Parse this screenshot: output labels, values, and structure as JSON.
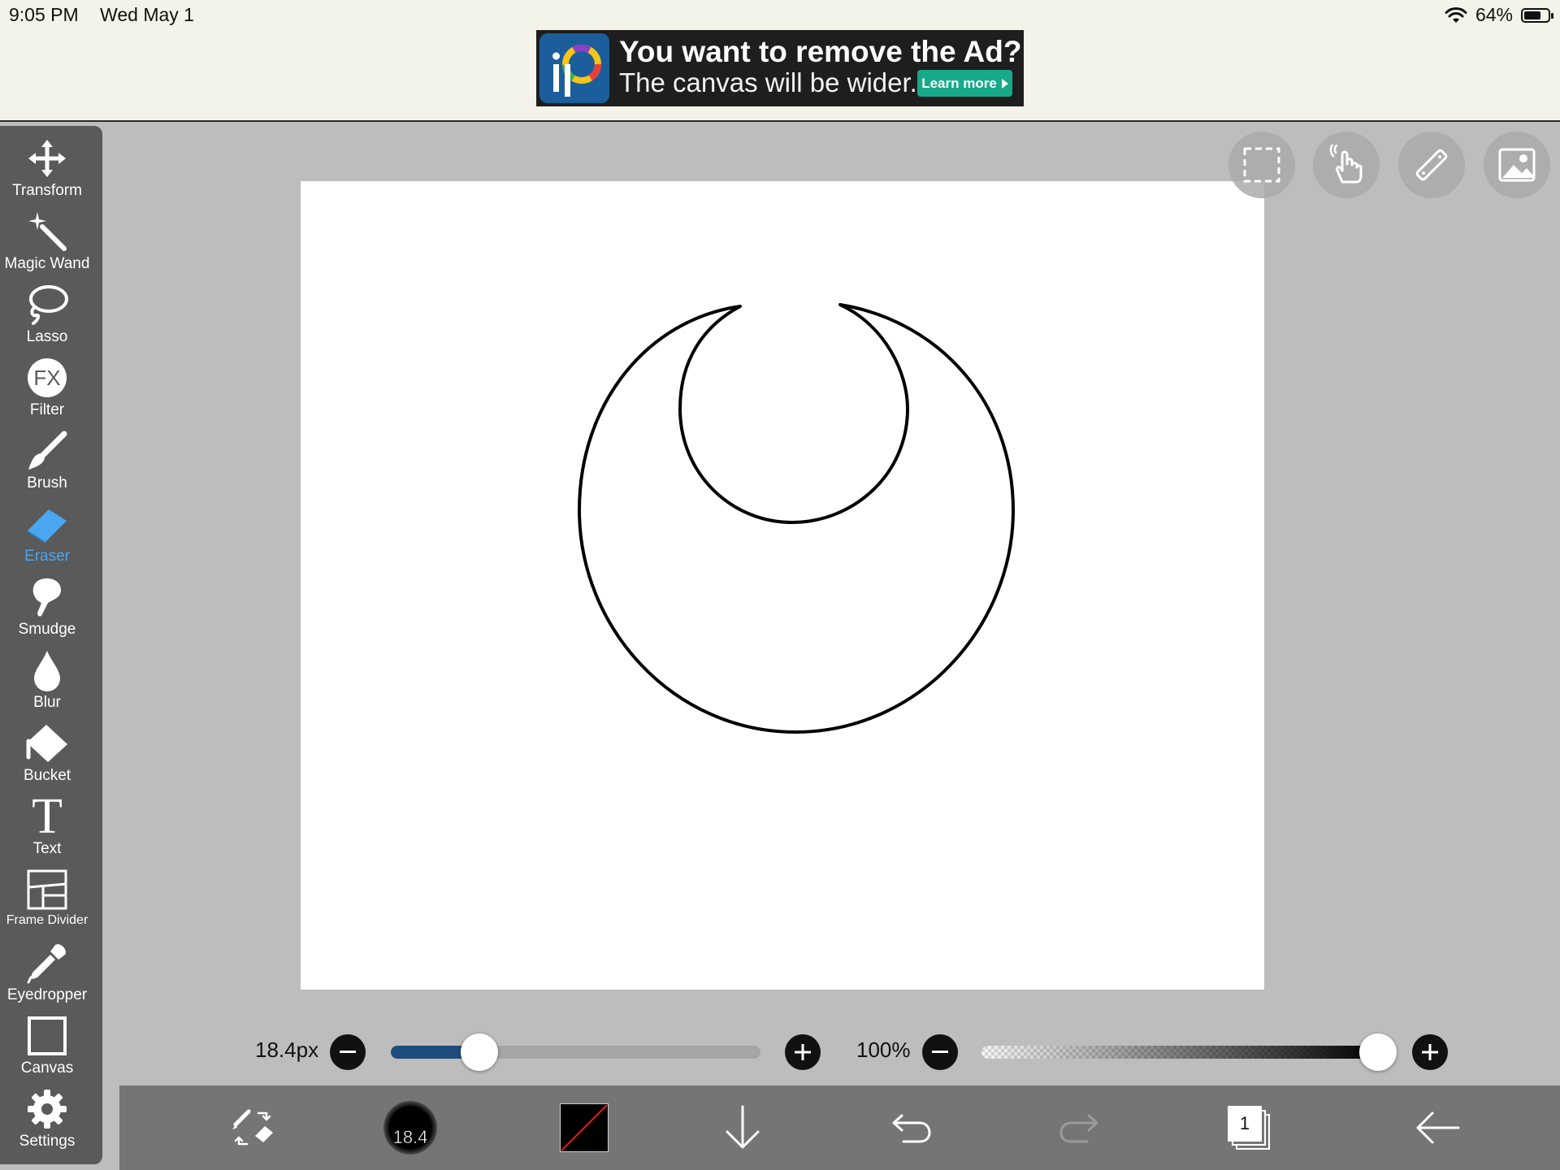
{
  "status_bar": {
    "time": "9:05 PM",
    "date": "Wed May 1",
    "battery": "64%"
  },
  "ad": {
    "title": "You want to remove the Ad?",
    "subtitle": "The canvas will be wider.",
    "button": "Learn more"
  },
  "tools": [
    {
      "label": "Transform",
      "icon": "move-arrows-icon"
    },
    {
      "label": "Magic Wand",
      "icon": "magic-wand-icon"
    },
    {
      "label": "Lasso",
      "icon": "lasso-icon"
    },
    {
      "label": "Filter",
      "icon": "fx-icon",
      "glyph": "FX"
    },
    {
      "label": "Brush",
      "icon": "brush-icon"
    },
    {
      "label": "Eraser",
      "icon": "eraser-icon",
      "active": true
    },
    {
      "label": "Smudge",
      "icon": "smudge-icon"
    },
    {
      "label": "Blur",
      "icon": "blur-drop-icon"
    },
    {
      "label": "Bucket",
      "icon": "bucket-icon"
    },
    {
      "label": "Text",
      "icon": "text-icon",
      "glyph": "T"
    },
    {
      "label": "Frame Divider",
      "icon": "frame-divider-icon"
    },
    {
      "label": "Eyedropper",
      "icon": "eyedropper-icon"
    },
    {
      "label": "Canvas",
      "icon": "canvas-icon"
    },
    {
      "label": "Settings",
      "icon": "gear-icon"
    }
  ],
  "brush_size": {
    "label": "18.4px",
    "fraction": 0.24
  },
  "opacity": {
    "label": "100%",
    "fraction": 1.0
  },
  "bottom_bar": {
    "brush_size_badge": "18.4",
    "layers_count": "1",
    "primary_color": "#000000"
  },
  "colors": {
    "accent": "#4aa6f0",
    "slider_fill": "#1e4c7d"
  }
}
